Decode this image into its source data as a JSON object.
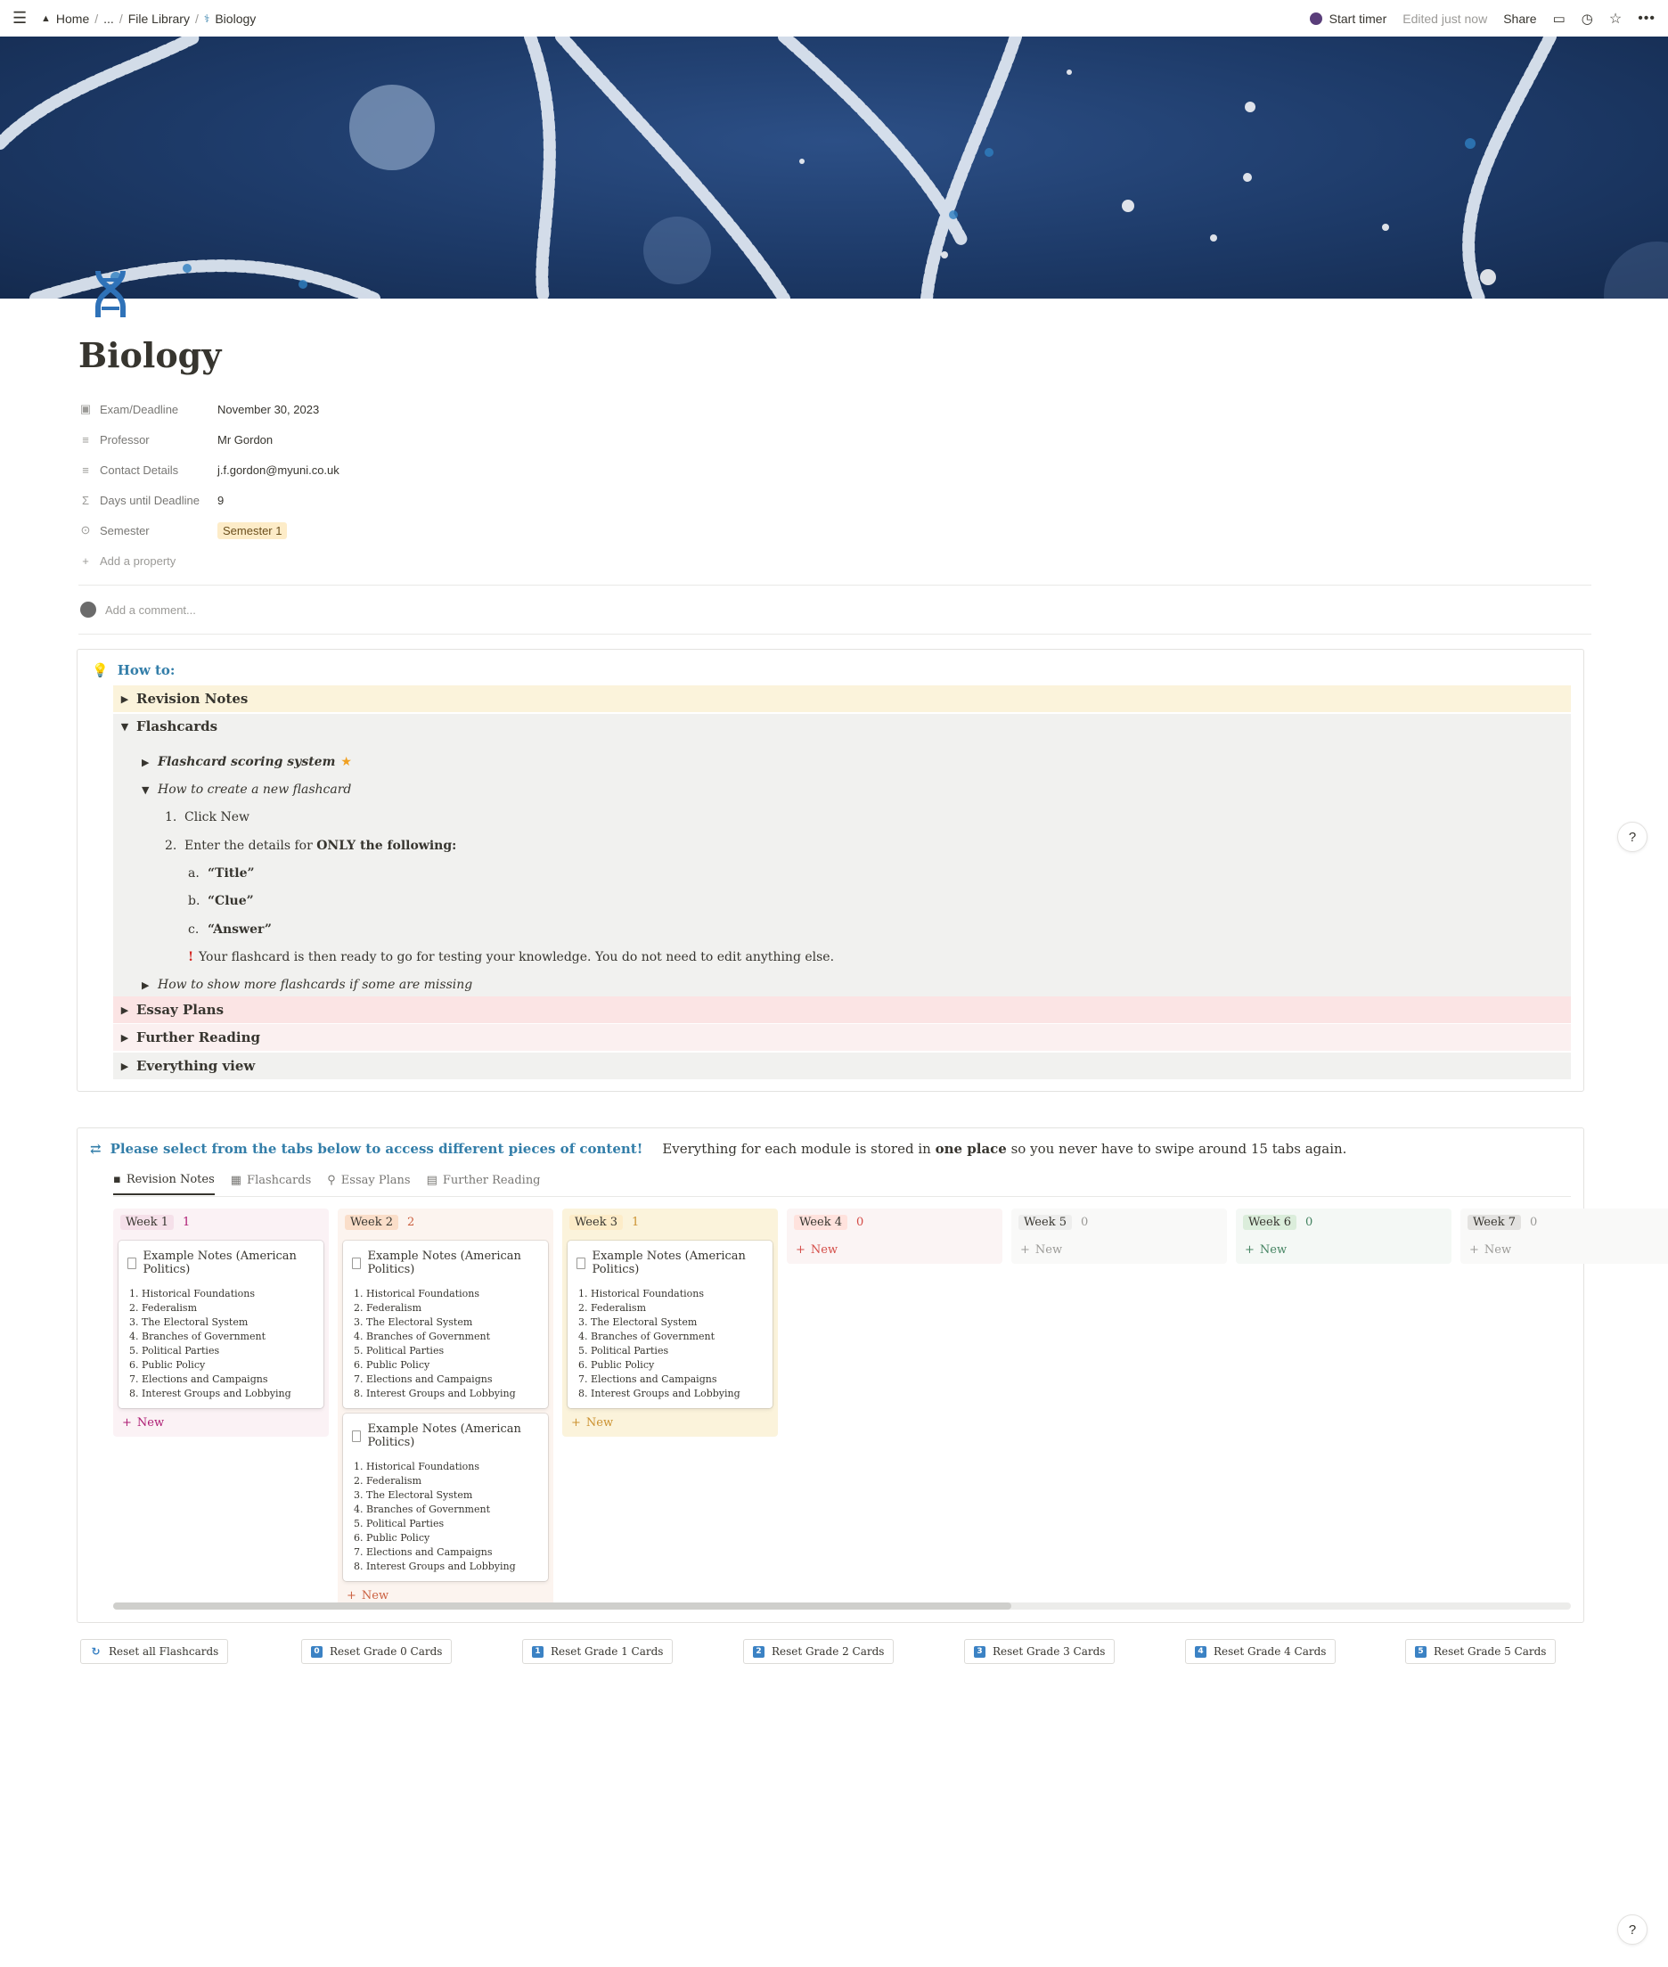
{
  "topbar": {
    "breadcrumb": [
      "Home",
      "...",
      "File Library",
      "Biology"
    ],
    "start_timer": "Start timer",
    "edited": "Edited just now",
    "share": "Share"
  },
  "page": {
    "title": "Biology",
    "add_property": "Add a property",
    "add_comment": "Add a comment..."
  },
  "properties": [
    {
      "name": "Exam/Deadline",
      "value": "November 30, 2023",
      "icon": "calendar-icon"
    },
    {
      "name": "Professor",
      "value": "Mr Gordon",
      "icon": "text-icon"
    },
    {
      "name": "Contact Details",
      "value": "j.f.gordon@myuni.co.uk",
      "icon": "text-icon"
    },
    {
      "name": "Days until Deadline",
      "value": "9",
      "icon": "formula-icon"
    },
    {
      "name": "Semester",
      "value": "Semester 1",
      "icon": "select-icon"
    }
  ],
  "howto": {
    "heading": "How to:",
    "toggles": [
      "Revision Notes",
      "Flashcards",
      "Essay Plans",
      "Further Reading",
      "Everything view"
    ],
    "flashcards": {
      "scoring": "Flashcard scoring system",
      "create": "How to create a new flashcard",
      "step1": "Click New",
      "step2_prefix": "Enter the details for ",
      "step2_bold": "ONLY the following:",
      "fields": [
        "“Title”",
        "“Clue”",
        "“Answer”"
      ],
      "note": "Your flashcard is then ready to go for testing your knowledge. You do not need to edit anything else.",
      "missing": "How to show more flashcards if some are missing"
    }
  },
  "content": {
    "heading": "Please select from the tabs below to access different pieces of content!",
    "desc_prefix": "Everything for each module is stored in ",
    "desc_bold": "one place",
    "desc_suffix": " so you never have to swipe around 15 tabs again.",
    "tabs": [
      "Revision Notes",
      "Flashcards",
      "Essay Plans",
      "Further Reading"
    ],
    "new_label": "New",
    "card_title": "Example Notes (American Politics)",
    "card_items": [
      "1. Historical Foundations",
      "2. Federalism",
      "3. The Electoral System",
      "4. Branches of Government",
      "5. Political Parties",
      "6. Public Policy",
      "7. Elections and Campaigns",
      "8. Interest Groups and Lobbying"
    ],
    "columns": [
      {
        "label": "Week 1",
        "count": "1",
        "color": "#ad1a72",
        "bg": "#fbf2f5",
        "tag": "#f5e0e9"
      },
      {
        "label": "Week 2",
        "count": "2",
        "color": "#cb6040",
        "bg": "#fcf4ef",
        "tag": "#fadec9"
      },
      {
        "label": "Week 3",
        "count": "1",
        "color": "#cb912f",
        "bg": "#fbf3db",
        "tag": "#fdecc8"
      },
      {
        "label": "Week 4",
        "count": "0",
        "color": "#d44c47",
        "bg": "#fbf4f4",
        "tag": "#ffe2dd"
      },
      {
        "label": "Week 5",
        "count": "0",
        "color": "#9b9a97",
        "bg": "#f9f9f8",
        "tag": "#eeeeed"
      },
      {
        "label": "Week 6",
        "count": "0",
        "color": "#448361",
        "bg": "#f4f8f5",
        "tag": "#dbeddb"
      },
      {
        "label": "Week 7",
        "count": "0",
        "color": "#9b9a97",
        "bg": "#f9f9f8",
        "tag": "#e3e2e0"
      }
    ]
  },
  "reset_buttons": [
    "Reset all Flashcards",
    "Reset Grade 0 Cards",
    "Reset Grade 1 Cards",
    "Reset Grade 2 Cards",
    "Reset Grade 3 Cards",
    "Reset Grade 4 Cards",
    "Reset Grade 5 Cards"
  ],
  "reset_icons": [
    "↻",
    "0",
    "1",
    "2",
    "3",
    "4",
    "5"
  ],
  "help": "?",
  "colors": {
    "accent": "#337ea9",
    "toggle_yellow": "#fbf3db",
    "toggle_pink": "#fbe4e4",
    "toggle_gray": "#f1f1ef"
  }
}
